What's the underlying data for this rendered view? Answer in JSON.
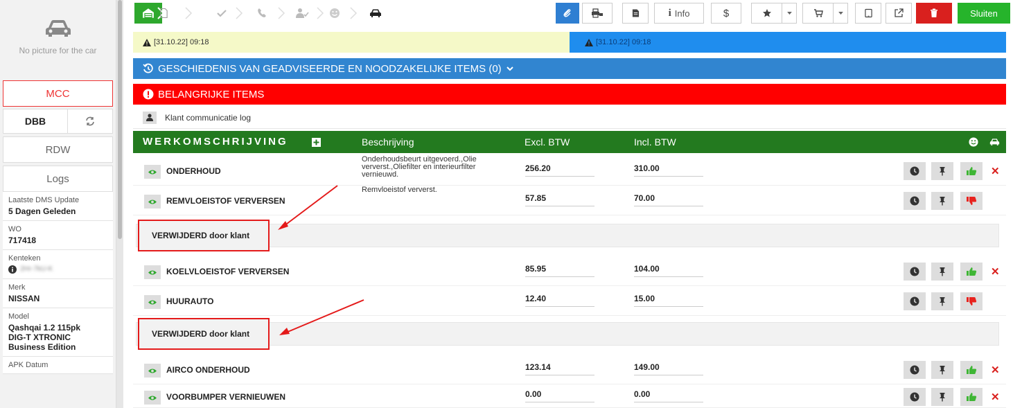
{
  "sidebar": {
    "no_picture": "No picture for the car",
    "mcc": "MCC",
    "dbb": "DBB",
    "rdw": "RDW",
    "logs": "Logs",
    "info": [
      {
        "label": "Laatste DMS Update",
        "value": "5 Dagen Geleden"
      },
      {
        "label": "WO",
        "value": "717418"
      },
      {
        "label": "Kenteken",
        "value": "2Hr-7kU-K"
      },
      {
        "label": "Merk",
        "value": "NISSAN"
      },
      {
        "label": "Model",
        "value": "Qashqai 1.2 115pk DIG-T XTRONIC Business Edition"
      },
      {
        "label": "APK Datum",
        "value": ""
      }
    ]
  },
  "toolbar": {
    "info_label": "Info",
    "dollar_label": "$",
    "close_label": "Sluiten",
    "colors": {
      "home_green": "#2ea82d",
      "blue": "#2f7fd2",
      "red": "#d9201e",
      "close_green": "#26b42b"
    }
  },
  "alerts": {
    "left": "[31.10.22] 09:18",
    "right": "[31.10.22] 09:18"
  },
  "history_bar": "GESCHIEDENIS VAN GEADVISEERDE EN NOODZAKELIJKE ITEMS (0)",
  "important_bar": "BELANGRIJKE ITEMS",
  "communication_log": "Klant communicatie log",
  "work_header": {
    "title": "WERKOMSCHRIJVING",
    "col_desc": "Beschrijving",
    "col_excl": "Excl. BTW",
    "col_incl": "Incl. BTW"
  },
  "items": [
    {
      "name": "ONDERHOUD",
      "desc": "Onderhoudsbeurt uitgevoerd.,Olie ververst.,Oliefilter en interieurfilter vernieuwd.",
      "excl": "256.20",
      "incl": "310.00",
      "status": "approved"
    },
    {
      "name": "REMVLOEISTOF VERVERSEN",
      "desc": "Remvloeistof ververst.",
      "excl": "57.85",
      "incl": "70.00",
      "status": "rejected"
    },
    {
      "name": "KOELVLOEISTOF VERVERSEN",
      "desc": "",
      "excl": "85.95",
      "incl": "104.00",
      "status": "approved"
    },
    {
      "name": "HUURAUTO",
      "desc": "",
      "excl": "12.40",
      "incl": "15.00",
      "status": "rejected"
    },
    {
      "name": "AIRCO ONDERHOUD",
      "desc": "",
      "excl": "123.14",
      "incl": "149.00",
      "status": "approved"
    },
    {
      "name": "VOORBUMPER VERNIEUWEN",
      "desc": "",
      "excl": "0.00",
      "incl": "0.00",
      "status": "approved"
    }
  ],
  "removed_label": "VERWIJDERD door klant"
}
